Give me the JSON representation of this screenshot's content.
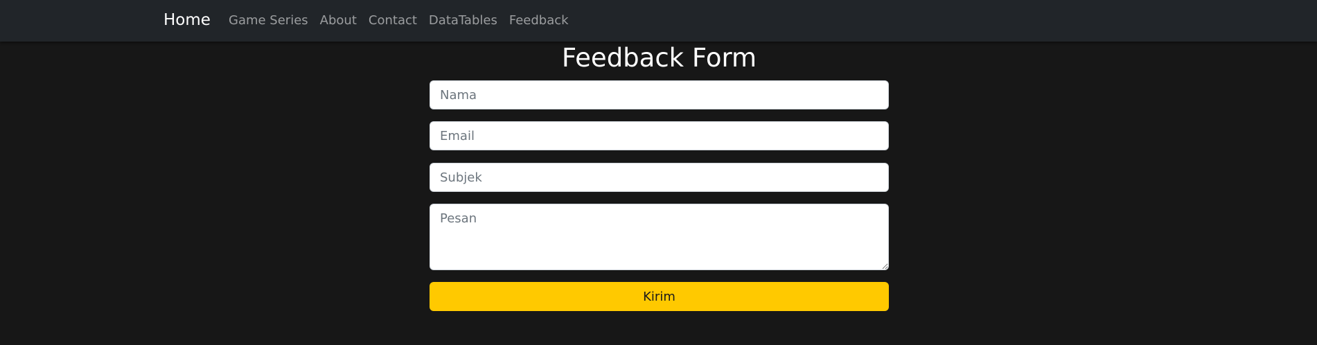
{
  "navbar": {
    "brand": "Home",
    "links": [
      {
        "label": "Game Series"
      },
      {
        "label": "About"
      },
      {
        "label": "Contact"
      },
      {
        "label": "DataTables"
      },
      {
        "label": "Feedback"
      }
    ]
  },
  "form": {
    "title": "Feedback Form",
    "name_placeholder": "Nama",
    "email_placeholder": "Email",
    "subject_placeholder": "Subjek",
    "message_placeholder": "Pesan",
    "submit_label": "Kirim"
  },
  "colors": {
    "page_background": "#171717",
    "navbar_background": "#212529",
    "submit_button": "#ffc900"
  }
}
